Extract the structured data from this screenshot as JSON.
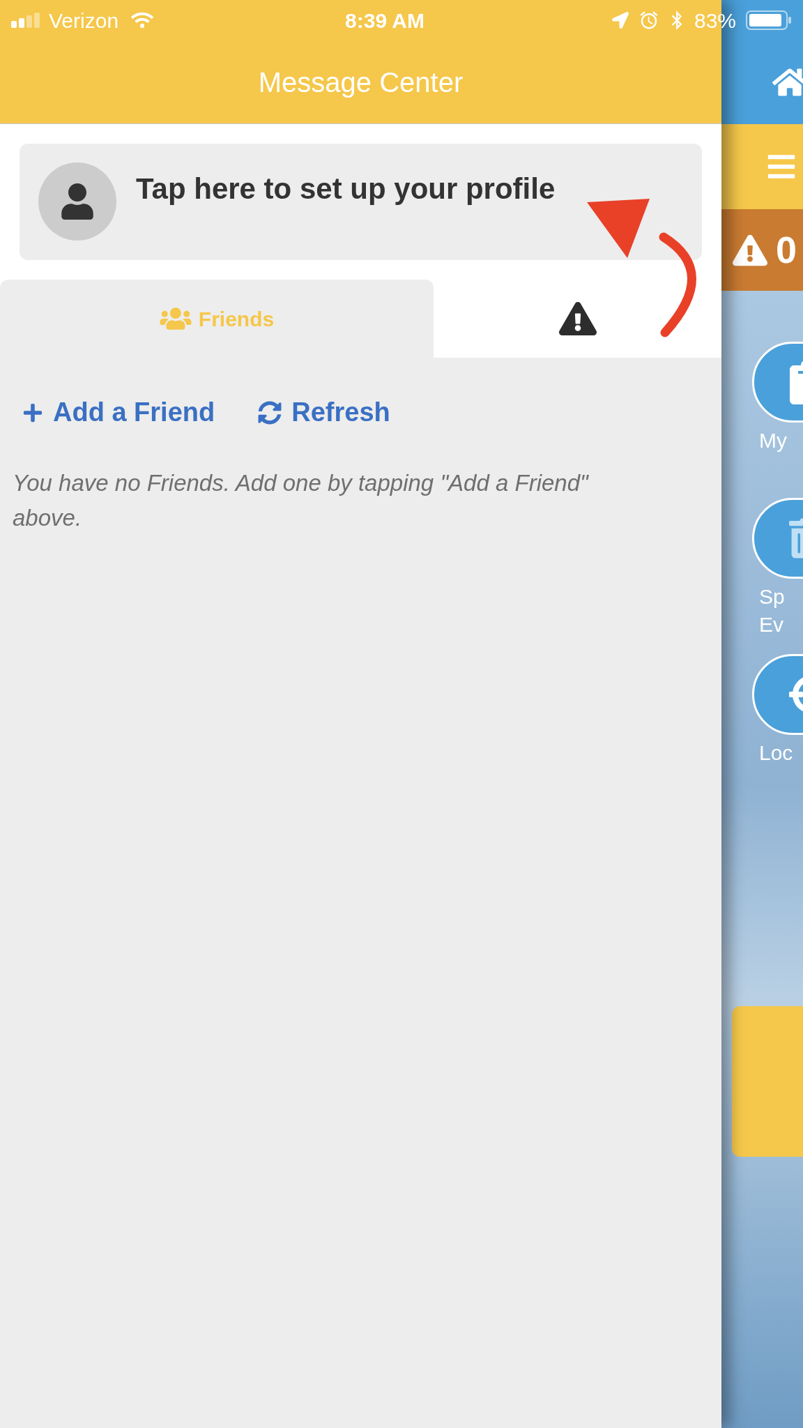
{
  "status_bar": {
    "carrier": "Verizon",
    "time": "8:39 AM",
    "battery": "83%"
  },
  "header": {
    "title": "Message Center"
  },
  "profile": {
    "prompt": "Tap here to set up your profile"
  },
  "tabs": [
    {
      "kind": "friends",
      "label": "Friends",
      "selected": true
    },
    {
      "kind": "alerts",
      "selected": false
    }
  ],
  "actions": [
    {
      "kind": "add",
      "label": "Add a Friend"
    },
    {
      "kind": "refresh",
      "label": "Refresh"
    }
  ],
  "empty_message": "You have no Friends. Add one by tapping \"Add a Friend\" above.",
  "side_panel": {
    "alert_count": "0",
    "buttons": [
      {
        "kind": "schedule",
        "lines": [
          "My"
        ]
      },
      {
        "kind": "events",
        "lines": [
          "Sp",
          "Ev"
        ]
      },
      {
        "kind": "location",
        "lines": [
          "Loc"
        ]
      }
    ]
  }
}
